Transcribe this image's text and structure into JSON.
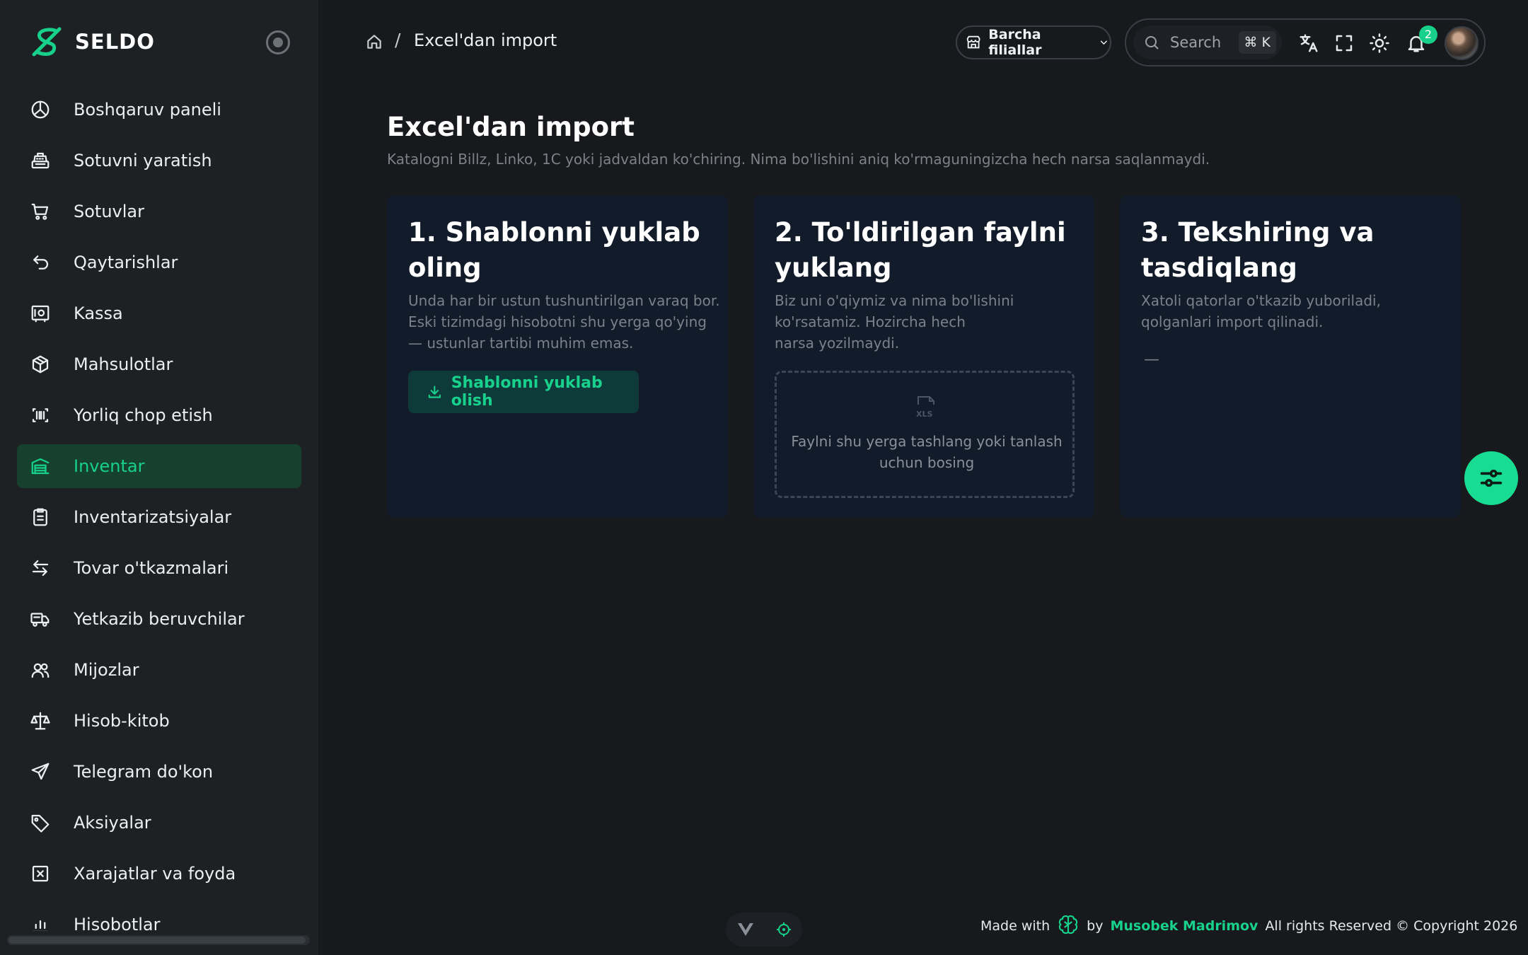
{
  "brand": {
    "name": "SELDO"
  },
  "sidebar": {
    "items": [
      {
        "label": "Boshqaruv paneli",
        "icon": "dashboard-icon"
      },
      {
        "label": "Sotuvni yaratish",
        "icon": "cash-register-icon"
      },
      {
        "label": "Sotuvlar",
        "icon": "cart-icon"
      },
      {
        "label": "Qaytarishlar",
        "icon": "return-icon"
      },
      {
        "label": "Kassa",
        "icon": "safe-icon"
      },
      {
        "label": "Mahsulotlar",
        "icon": "box-icon"
      },
      {
        "label": "Yorliq chop etish",
        "icon": "barcode-icon"
      },
      {
        "label": "Inventar",
        "icon": "warehouse-icon",
        "active": true
      },
      {
        "label": "Inventarizatsiyalar",
        "icon": "clipboard-icon"
      },
      {
        "label": "Tovar o'tkazmalari",
        "icon": "transfer-icon"
      },
      {
        "label": "Yetkazib beruvchilar",
        "icon": "truck-icon"
      },
      {
        "label": "Mijozlar",
        "icon": "users-icon"
      },
      {
        "label": "Hisob-kitob",
        "icon": "scale-icon"
      },
      {
        "label": "Telegram do'kon",
        "icon": "send-icon"
      },
      {
        "label": "Aksiyalar",
        "icon": "tag-icon"
      },
      {
        "label": "Xarajatlar va foyda",
        "icon": "expense-icon"
      },
      {
        "label": "Hisobotlar",
        "icon": "report-icon"
      }
    ]
  },
  "header": {
    "breadcrumb_current": "Excel'dan import",
    "breadcrumb_separator": "/",
    "branch_select": "Barcha filiallar",
    "search_placeholder": "Search",
    "search_shortcut": "⌘ K",
    "notification_count": "2"
  },
  "main": {
    "title": "Excel'dan import",
    "subtitle": "Katalogni Billz, Linko, 1C yoki jadvaldan ko'chiring. Nima bo'lishini aniq ko'rmaguningizcha hech narsa saqlanmaydi.",
    "steps": [
      {
        "title": "1. Shablonni yuklab oling",
        "text": "Unda har bir ustun tushuntirilgan varaq bor.\nEski tizimdagi hisobotni shu yerga qo'ying\n— ustunlar tartibi muhim emas.",
        "button": "Shablonni yuklab olish"
      },
      {
        "title": "2. To'ldirilgan faylni yuklang",
        "text": "Biz uni o'qiymiz va nima bo'lishini\nko'rsatamiz. Hozircha hech\nnarsa yozilmaydi.",
        "dropzone_icon_text": "XLS",
        "dropzone_text": "Faylni shu yerga tashlang yoki tanlash uchun bosing"
      },
      {
        "title": "3. Tekshiring va tasdiqlang",
        "text": "Xatoli qatorlar o'tkazib yuboriladi,\nqolganlari import qilinadi.",
        "placeholder": "—"
      }
    ]
  },
  "footer": {
    "made_with": "Made with",
    "by": "by",
    "author": "Musobek Madrimov",
    "rights": "All rights Reserved © Copyright 2026"
  },
  "colors": {
    "accent": "#17d08a",
    "background": "#17191c",
    "sidebar": "#1e2124",
    "card": "#121b2a"
  }
}
